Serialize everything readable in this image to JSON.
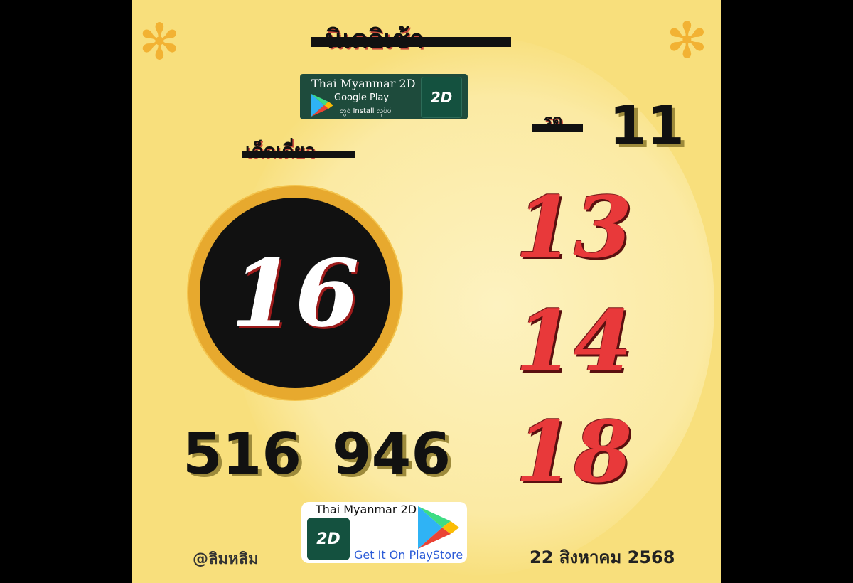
{
  "header": {
    "title_scribble": "นิเคอิเช้า",
    "left_label_scribble": "เด็ดเดี่ยว",
    "right_label_scribble": "รูด"
  },
  "decor": {
    "star_left_icon": "asterisk-flower",
    "star_right_icon": "asterisk-flower"
  },
  "numbers": {
    "circle_main": "16",
    "top_right": "11",
    "right_list": [
      "13",
      "14",
      "18"
    ],
    "three_digit_left": "516",
    "three_digit_right": "946"
  },
  "ad_top": {
    "app_name": "Thai Myanmar 2D",
    "store": "Google Play",
    "install_text": "တွင် Install လုပ်ပါ",
    "logo_text": "2D"
  },
  "ad_bottom": {
    "app_name": "Thai Myanmar 2D",
    "logo_text": "2D",
    "cta": "Get It On PlayStore"
  },
  "footer": {
    "handle": "@ลิมหลิม",
    "date": "22 สิงหาคม 2568"
  },
  "colors": {
    "background": "#f8df7c",
    "accent_red": "#e8393a",
    "ring": "#e7a92e",
    "badge_green": "#1e4b3c",
    "cta_blue": "#2b5bd7"
  }
}
